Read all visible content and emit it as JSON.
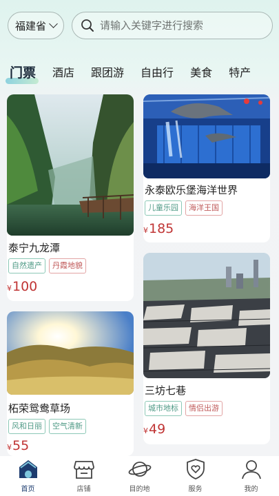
{
  "header": {
    "province": "福建省",
    "search_placeholder": "请输入关键字进行搜索"
  },
  "tabs": [
    {
      "label": "门票",
      "active": true
    },
    {
      "label": "酒店"
    },
    {
      "label": "跟团游"
    },
    {
      "label": "自由行"
    },
    {
      "label": "美食"
    },
    {
      "label": "特产"
    }
  ],
  "cards": [
    {
      "title": "泰宁九龙潭",
      "tags": [
        "自然遗产",
        "丹霞地貌"
      ],
      "price_symbol": "¥",
      "price": "100"
    },
    {
      "title": "永泰欧乐堡海洋世界",
      "tags": [
        "儿童乐园",
        "海洋王国"
      ],
      "price_symbol": "¥",
      "price": "185"
    },
    {
      "title": "柘荣鸳鸯草场",
      "tags": [
        "风和日丽",
        "空气清新"
      ],
      "price_symbol": "¥",
      "price": "55"
    },
    {
      "title": "三坊七巷",
      "tags": [
        "城市地标",
        "情侣出游"
      ],
      "price_symbol": "¥",
      "price": "49"
    }
  ],
  "nav": [
    {
      "label": "首页",
      "icon": "home-icon",
      "active": true
    },
    {
      "label": "店铺",
      "icon": "store-icon"
    },
    {
      "label": "目的地",
      "icon": "planet-icon"
    },
    {
      "label": "服务",
      "icon": "shield-heart-icon"
    },
    {
      "label": "我的",
      "icon": "user-icon"
    }
  ],
  "colors": {
    "accent": "#1d3c6f",
    "price": "#c03535",
    "tag_green": "#4f9a86",
    "tag_red": "#c05a5a"
  }
}
